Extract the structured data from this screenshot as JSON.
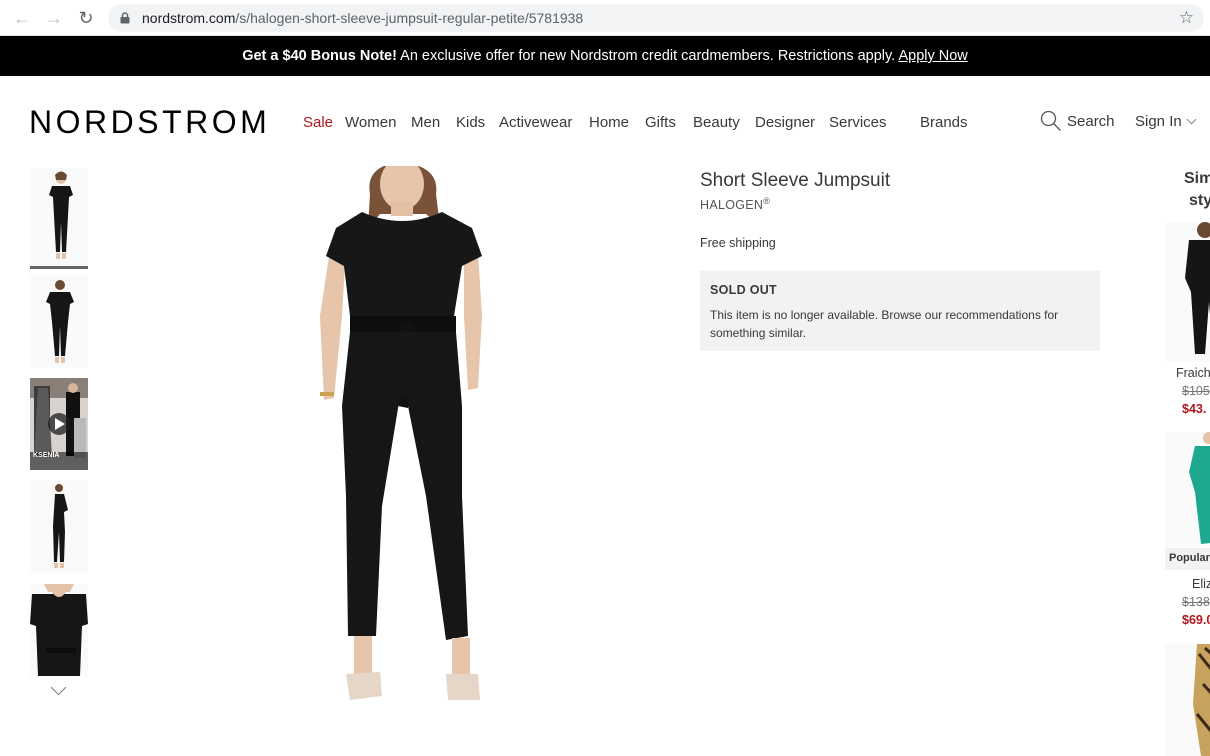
{
  "browser": {
    "url_host": "nordstrom.com",
    "url_path": "/s/halogen-short-sleeve-jumpsuit-regular-petite/5781938"
  },
  "promo": {
    "bold": "Get a $40 Bonus Note!",
    "text": " An exclusive offer for new Nordstrom credit cardmembers. Restrictions apply. ",
    "link": "Apply Now"
  },
  "header": {
    "logo": "NORDSTROM",
    "nav": [
      "Sale",
      "Women",
      "Men",
      "Kids",
      "Activewear",
      "Home",
      "Gifts",
      "Beauty",
      "Designer",
      "Services",
      "Brands"
    ],
    "search_label": "Search",
    "signin_label": "Sign In"
  },
  "product": {
    "title": "Short Sleeve Jumpsuit",
    "brand": "HALOGEN",
    "brand_mark": "®",
    "shipping": "Free shipping",
    "status_title": "SOLD OUT",
    "status_message": "This item is no longer available. Browse our recommendations for something similar.",
    "video_caption": "KSENIA"
  },
  "similar": {
    "title_line1": "Sim",
    "title_line2": "sty",
    "items": [
      {
        "name": "Fraich",
        "was": "$105",
        "now": "$43."
      },
      {
        "badge": "Popular",
        "name": "Eliz",
        "was": "$138",
        "now": "$69.0"
      }
    ]
  },
  "colors": {
    "sale_red": "#b4161f",
    "banner_bg": "#000000",
    "soldout_bg": "#f2f2f2"
  }
}
